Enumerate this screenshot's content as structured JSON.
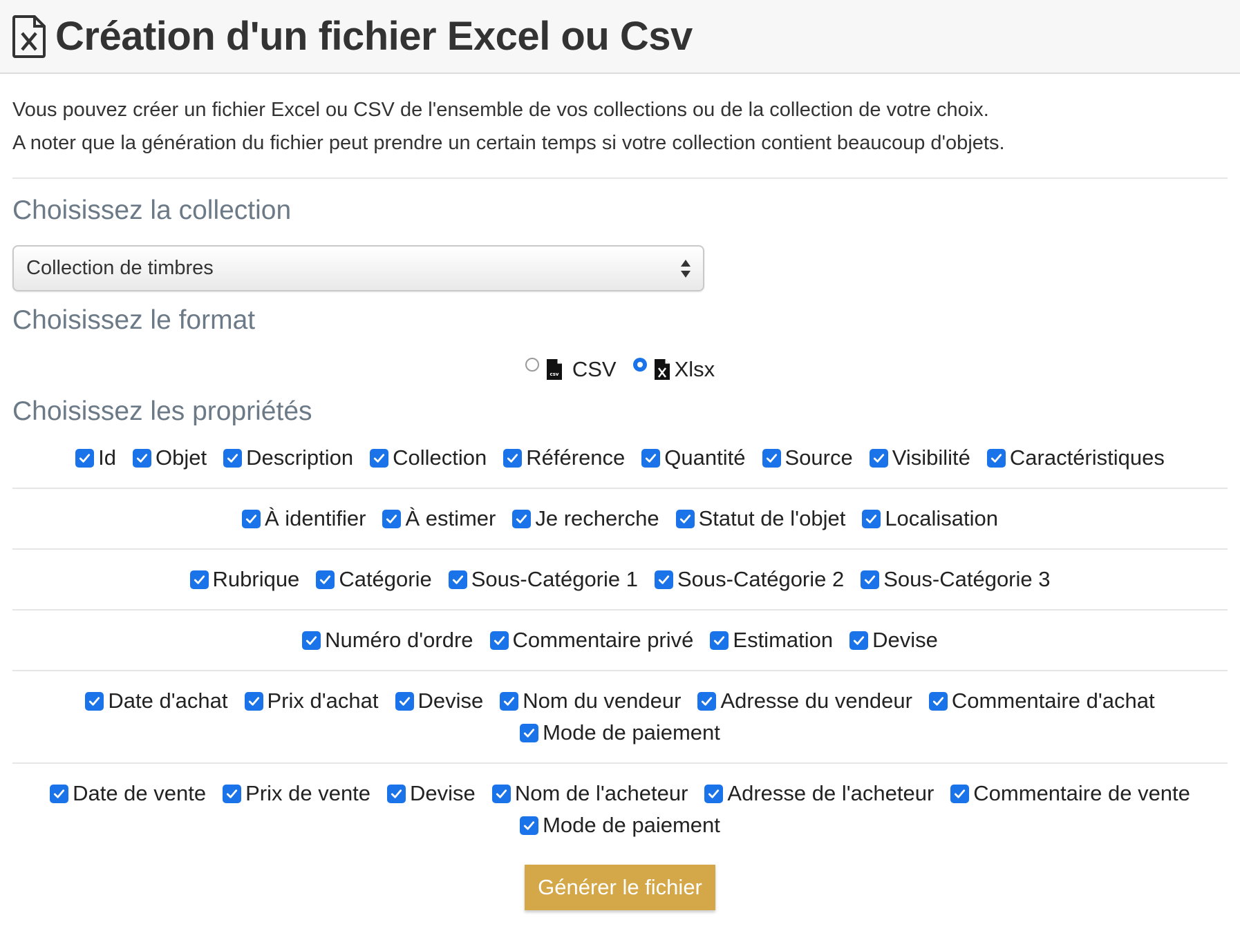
{
  "header": {
    "title": "Création d'un fichier Excel ou Csv",
    "icon": "excel-file-icon"
  },
  "intro": {
    "line1": "Vous pouvez créer un fichier Excel ou CSV de l'ensemble de vos collections ou de la collection de votre choix.",
    "line2": "A noter que la génération du fichier peut prendre un certain temps si votre collection contient beaucoup d'objets."
  },
  "collection": {
    "title": "Choisissez la collection",
    "selected": "Collection de timbres"
  },
  "format": {
    "title": "Choisissez le format",
    "options": [
      {
        "label": "CSV",
        "checked": false,
        "icon": "csv-file-icon"
      },
      {
        "label": "Xlsx",
        "checked": true,
        "icon": "excel-file-icon"
      }
    ]
  },
  "properties": {
    "title": "Choisissez les propriétés",
    "rows": [
      [
        {
          "label": "Id",
          "checked": true
        },
        {
          "label": "Objet",
          "checked": true
        },
        {
          "label": "Description",
          "checked": true
        },
        {
          "label": "Collection",
          "checked": true
        },
        {
          "label": "Référence",
          "checked": true
        },
        {
          "label": "Quantité",
          "checked": true
        },
        {
          "label": "Source",
          "checked": true
        },
        {
          "label": "Visibilité",
          "checked": true
        },
        {
          "label": "Caractéristiques",
          "checked": true
        }
      ],
      [
        {
          "label": "À identifier",
          "checked": true
        },
        {
          "label": "À estimer",
          "checked": true
        },
        {
          "label": "Je recherche",
          "checked": true
        },
        {
          "label": "Statut de l'objet",
          "checked": true
        },
        {
          "label": "Localisation",
          "checked": true
        }
      ],
      [
        {
          "label": "Rubrique",
          "checked": true
        },
        {
          "label": "Catégorie",
          "checked": true
        },
        {
          "label": "Sous-Catégorie 1",
          "checked": true
        },
        {
          "label": "Sous-Catégorie 2",
          "checked": true
        },
        {
          "label": "Sous-Catégorie 3",
          "checked": true
        }
      ],
      [
        {
          "label": "Numéro d'ordre",
          "checked": true
        },
        {
          "label": "Commentaire privé",
          "checked": true
        },
        {
          "label": "Estimation",
          "checked": true
        },
        {
          "label": "Devise",
          "checked": true
        }
      ],
      [
        {
          "label": "Date d'achat",
          "checked": true
        },
        {
          "label": "Prix d'achat",
          "checked": true
        },
        {
          "label": "Devise",
          "checked": true
        },
        {
          "label": "Nom du vendeur",
          "checked": true
        },
        {
          "label": "Adresse du vendeur",
          "checked": true
        },
        {
          "label": "Commentaire d'achat",
          "checked": true
        },
        {
          "label": "Mode de paiement",
          "checked": true
        }
      ],
      [
        {
          "label": "Date de vente",
          "checked": true
        },
        {
          "label": "Prix de vente",
          "checked": true
        },
        {
          "label": "Devise",
          "checked": true
        },
        {
          "label": "Nom de l'acheteur",
          "checked": true
        },
        {
          "label": "Adresse de l'acheteur",
          "checked": true
        },
        {
          "label": "Commentaire de vente",
          "checked": true
        },
        {
          "label": "Mode de paiement",
          "checked": true
        }
      ]
    ]
  },
  "button": {
    "label": "Générer le fichier",
    "color": "#d4a849"
  },
  "colors": {
    "checkbox": "#1a73e8",
    "section_title": "#6b7a86"
  }
}
